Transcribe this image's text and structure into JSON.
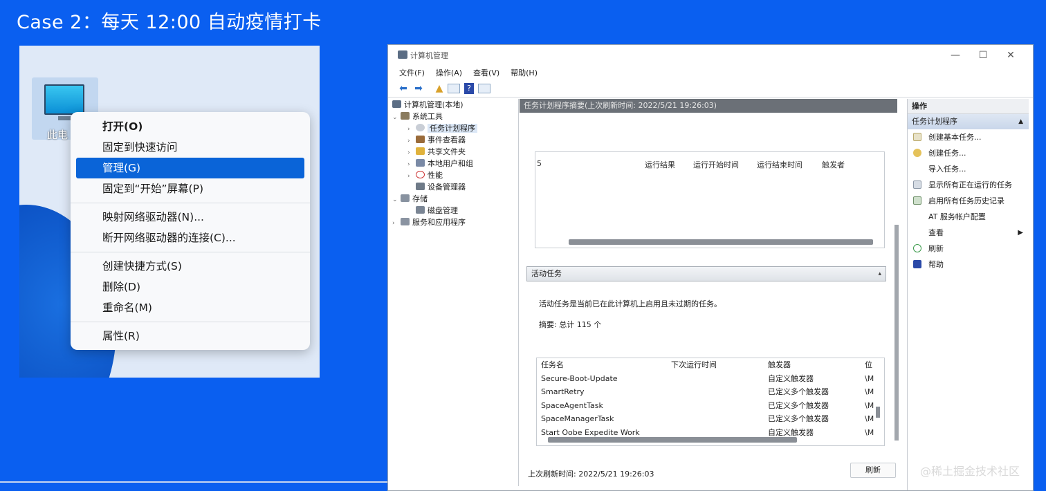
{
  "slide": {
    "title": "Case 2：每天 12:00 自动疫情打卡"
  },
  "desktop": {
    "icon_label": "此电",
    "context_menu": {
      "items": [
        {
          "label": "打开(O)"
        },
        {
          "label": "固定到快速访问"
        },
        {
          "label": "管理(G)"
        },
        {
          "label": "固定到“开始”屏幕(P)"
        },
        {
          "label": "映射网络驱动器(N)..."
        },
        {
          "label": "断开网络驱动器的连接(C)..."
        },
        {
          "label": "创建快捷方式(S)"
        },
        {
          "label": "删除(D)"
        },
        {
          "label": "重命名(M)"
        },
        {
          "label": "属性(R)"
        }
      ]
    }
  },
  "window": {
    "title": "计算机管理",
    "controls": {
      "minimize": "—",
      "maximize": "☐",
      "close": "✕"
    },
    "menu": [
      "文件(F)",
      "操作(A)",
      "查看(V)",
      "帮助(H)"
    ],
    "tree": [
      {
        "label": "计算机管理(本地)"
      },
      {
        "label": "系统工具"
      },
      {
        "label": "任务计划程序"
      },
      {
        "label": "事件查看器"
      },
      {
        "label": "共享文件夹"
      },
      {
        "label": "本地用户和组"
      },
      {
        "label": "性能"
      },
      {
        "label": "设备管理器"
      },
      {
        "label": "存储"
      },
      {
        "label": "磁盘管理"
      },
      {
        "label": "服务和应用程序"
      }
    ],
    "center": {
      "header": "任务计划程序摘要(上次刷新时间: 2022/5/21 19:26:03)",
      "result_columns": [
        "运行结果",
        "运行开始时间",
        "运行结束时间",
        "触发者"
      ],
      "result_first_col": "5",
      "active_section": "活动任务",
      "active_desc": "活动任务是当前已在此计算机上启用且未过期的任务。",
      "summary": "摘要: 总计 115 个",
      "task_headers": [
        "任务名",
        "下次运行时间",
        "触发器",
        "位"
      ],
      "tasks": [
        {
          "name": "Secure-Boot-Update",
          "trigger": "自定义触发器",
          "loc": "\\M"
        },
        {
          "name": "SmartRetry",
          "trigger": "已定义多个触发器",
          "loc": "\\M"
        },
        {
          "name": "SpaceAgentTask",
          "trigger": "已定义多个触发器",
          "loc": "\\M"
        },
        {
          "name": "SpaceManagerTask",
          "trigger": "已定义多个触发器",
          "loc": "\\M"
        },
        {
          "name": "Start Oobe Expedite Work",
          "trigger": "自定义触发器",
          "loc": "\\M"
        }
      ],
      "footer_label": "上次刷新时间: 2022/5/21 19:26:03",
      "refresh_button": "刷新"
    },
    "actions": {
      "header": "操作",
      "subheader": "任务计划程序",
      "items": [
        {
          "label": "创建基本任务..."
        },
        {
          "label": "创建任务..."
        },
        {
          "label": "导入任务..."
        },
        {
          "label": "显示所有正在运行的任务"
        },
        {
          "label": "启用所有任务历史记录"
        },
        {
          "label": "AT 服务帐户配置"
        },
        {
          "label": "查看"
        },
        {
          "label": "刷新"
        },
        {
          "label": "帮助"
        }
      ]
    }
  },
  "watermark": "@稀土掘金技术社区"
}
